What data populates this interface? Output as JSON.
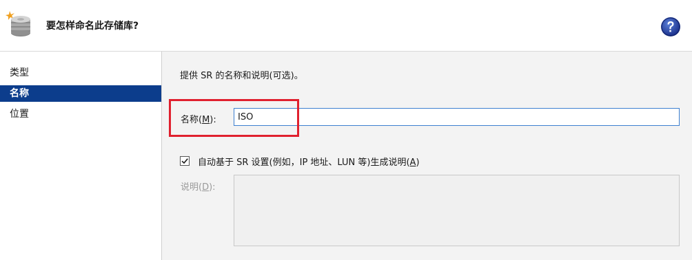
{
  "header": {
    "title": "要怎样命名此存储库?",
    "icon": "storage-disk-icon",
    "help_icon": "help-icon"
  },
  "sidebar": {
    "items": [
      {
        "label": "类型",
        "selected": false
      },
      {
        "label": "名称",
        "selected": true
      },
      {
        "label": "位置",
        "selected": false
      }
    ]
  },
  "main": {
    "description": "提供 SR 的名称和说明(可选)。",
    "name_label": "名称(",
    "name_accel": "M",
    "name_label_end": "):",
    "name_value": "ISO",
    "auto_desc_checked": true,
    "auto_desc_label": "自动基于 SR 设置(例如，IP 地址、LUN 等)生成说明(",
    "auto_desc_accel": "A",
    "auto_desc_label_end": ")",
    "desc_label": "说明(",
    "desc_accel": "D",
    "desc_label_end": "):",
    "desc_value": ""
  },
  "colors": {
    "selected_nav": "#0c3d8c",
    "highlight": "#e0202e",
    "input_border": "#3c7fd0"
  }
}
